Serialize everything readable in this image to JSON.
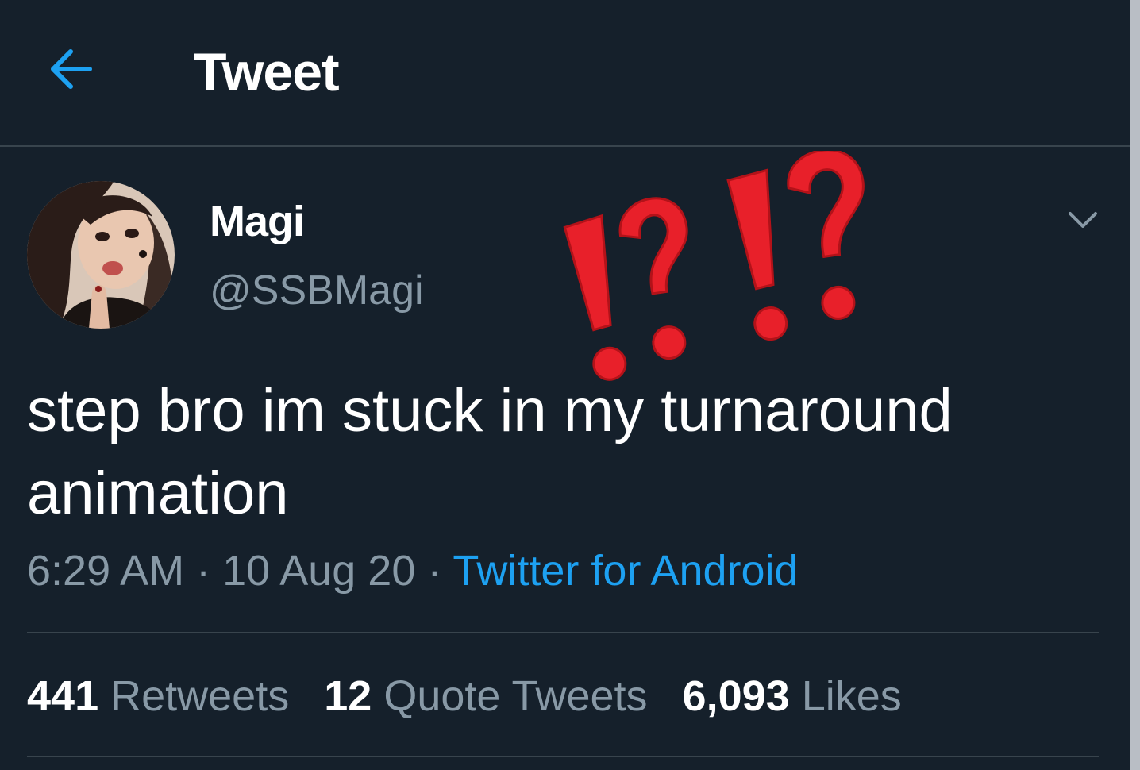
{
  "header": {
    "back_icon": "arrow-left-icon",
    "title": "Tweet"
  },
  "author": {
    "display_name": "Magi",
    "handle": "@SSBMagi",
    "avatar_icon": "profile-photo"
  },
  "overlay": {
    "emoji": "⁉⁉",
    "emoji_name": "exclamation-question-mark-icon"
  },
  "tweet": {
    "text": "step bro im stuck in my turnaround animation",
    "time": "6:29 AM",
    "sep1": " · ",
    "date": "10 Aug 20",
    "sep2": " · ",
    "source": "Twitter for Android",
    "more_icon": "chevron-down-icon"
  },
  "stats": {
    "retweets_count": "441",
    "retweets_label": "Retweets",
    "quotes_count": "12",
    "quotes_label": "Quote Tweets",
    "likes_count": "6,093",
    "likes_label": "Likes"
  },
  "colors": {
    "background": "#15202b",
    "accent": "#1da1f2",
    "secondary_text": "#8899a6",
    "divider": "#38444d",
    "emoji_red": "#e8202a"
  }
}
